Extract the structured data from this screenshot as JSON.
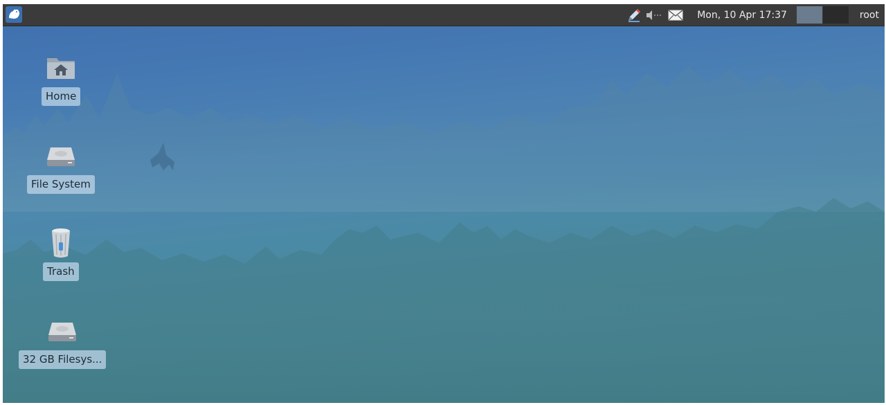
{
  "panel": {
    "clock": "Mon, 10 Apr  17:37",
    "user": "root",
    "icons": [
      "whisker-menu-icon",
      "text-editor-icon",
      "volume-icon",
      "mail-icon"
    ],
    "colors": {
      "panel_bg": "#3b3b3b",
      "workspace_active": "#6a7c8e",
      "workspace_inactive": "#2a2a2a"
    }
  },
  "desktop": {
    "icons": [
      {
        "label": "Home",
        "icon": "home-folder-icon"
      },
      {
        "label": "File System",
        "icon": "drive-icon"
      },
      {
        "label": "Trash",
        "icon": "trash-icon"
      },
      {
        "label": "32 GB Filesys...",
        "icon": "drive-icon"
      }
    ]
  }
}
